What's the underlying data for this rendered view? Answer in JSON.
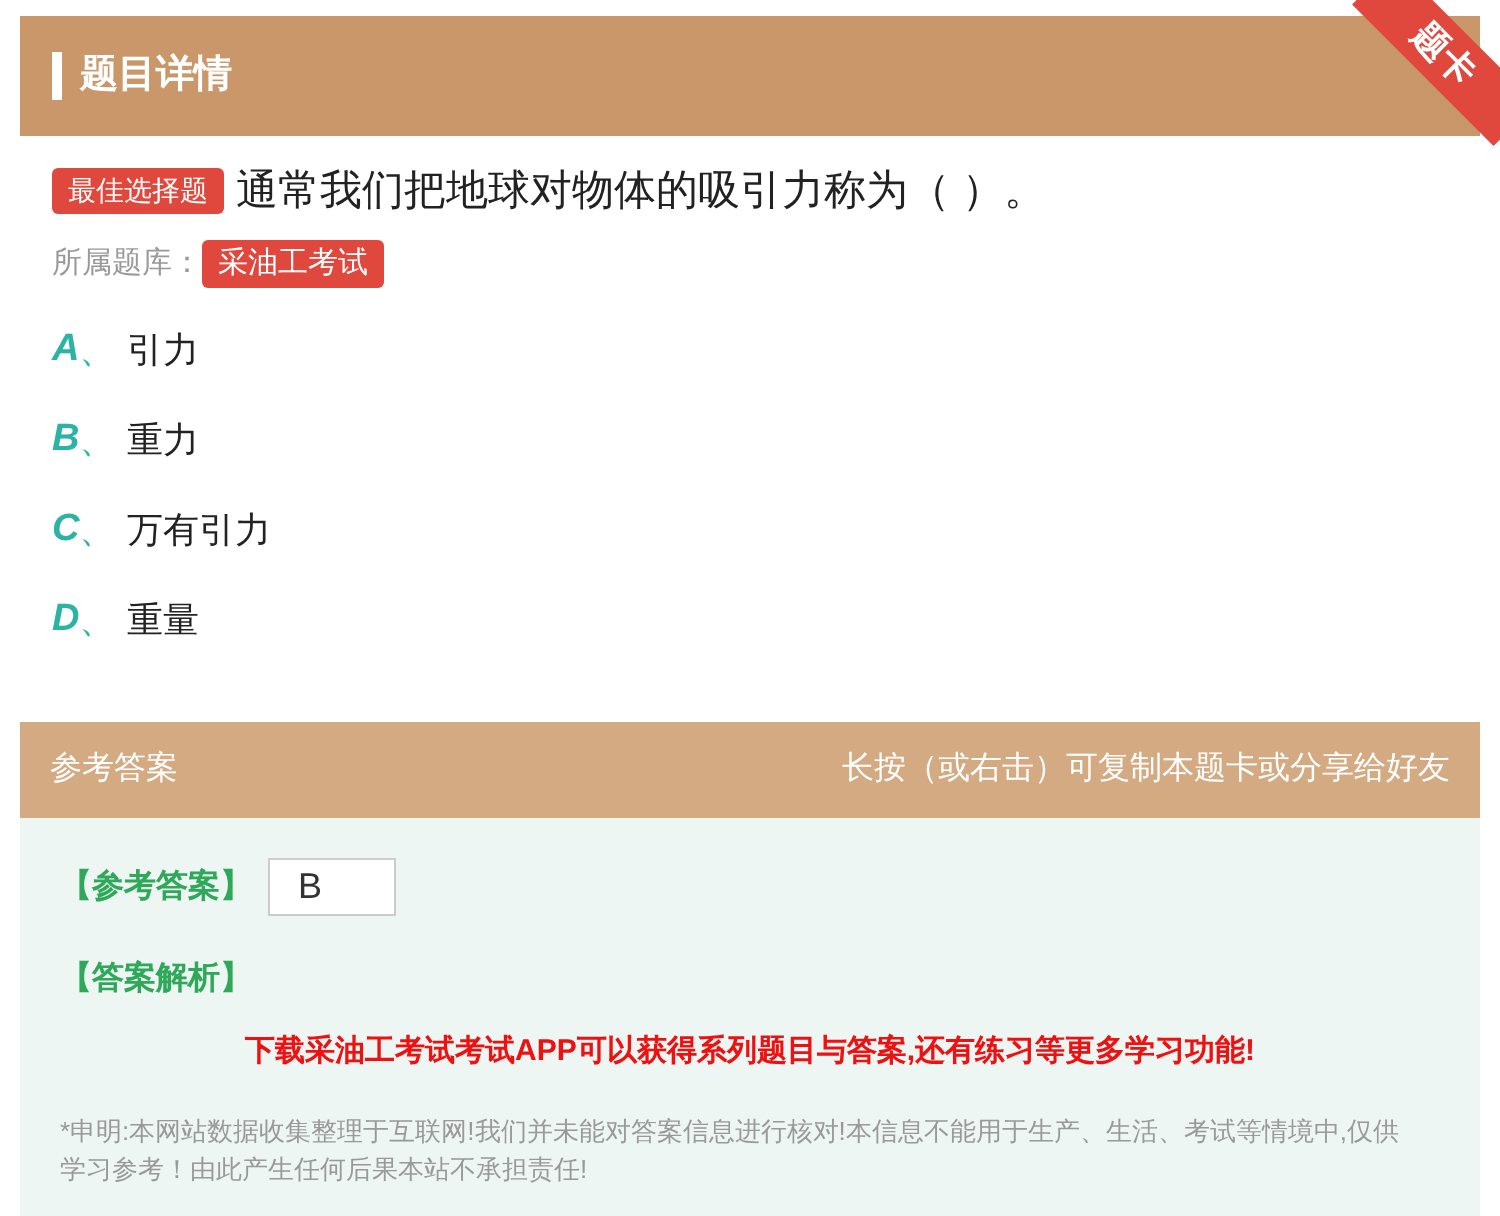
{
  "header": {
    "title": "题目详情",
    "ribbon": "题卡"
  },
  "question": {
    "type_badge": "最佳选择题",
    "text": "通常我们把地球对物体的吸引力称为（ ）。",
    "bank_label": "所属题库：",
    "bank": "采油工考试"
  },
  "options": [
    {
      "letter": "A",
      "sep": "、",
      "text": "引力"
    },
    {
      "letter": "B",
      "sep": "、",
      "text": "重力"
    },
    {
      "letter": "C",
      "sep": "、",
      "text": "万有引力"
    },
    {
      "letter": "D",
      "sep": "、",
      "text": "重量"
    }
  ],
  "answer_bar": {
    "title": "参考答案",
    "hint": "长按（或右击）可复制本题卡或分享给好友"
  },
  "answer": {
    "label": "【参考答案】",
    "value": "B",
    "analysis_label": "【答案解析】",
    "promo": "下载采油工考试考试APP可以获得系列题目与答案,还有练习等更多学习功能!",
    "disclaimer": "*申明:本网站数据收集整理于互联网!我们并未能对答案信息进行核对!本信息不能用于生产、生活、考试等情境中,仅供学习参考！由此产生任何后果本站不承担责任!"
  }
}
